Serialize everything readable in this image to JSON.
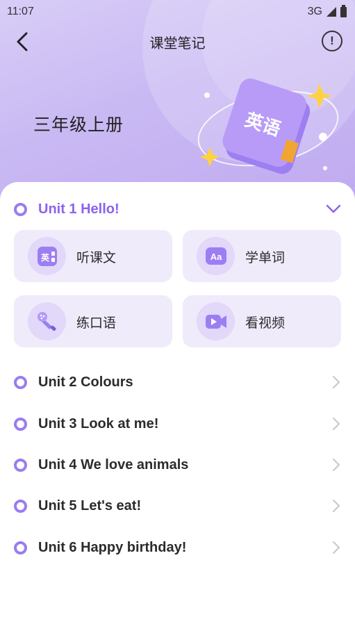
{
  "status_bar": {
    "time": "11:07",
    "network": "3G"
  },
  "nav": {
    "title": "课堂笔记"
  },
  "header": {
    "grade_title": "三年级上册",
    "book_text": "英语"
  },
  "units": [
    {
      "label": "Unit 1 Hello!",
      "expanded": true
    },
    {
      "label": "Unit 2 Colours",
      "expanded": false
    },
    {
      "label": "Unit 3 Look at me!",
      "expanded": false
    },
    {
      "label": "Unit 4 We love animals",
      "expanded": false
    },
    {
      "label": "Unit 5 Let's eat!",
      "expanded": false
    },
    {
      "label": "Unit 6 Happy birthday!",
      "expanded": false
    }
  ],
  "unit1_actions": [
    {
      "label": "听课文",
      "icon": "textbook-icon",
      "icon_text": "英"
    },
    {
      "label": "学单词",
      "icon": "vocabulary-icon",
      "icon_text": "Aa"
    },
    {
      "label": "练口语",
      "icon": "megaphone-icon"
    },
    {
      "label": "看视频",
      "icon": "video-camera-icon"
    }
  ],
  "colors": {
    "accent": "#8a63ef",
    "tile_bg": "#efebfb",
    "header_bg": "#c9b9f3"
  }
}
